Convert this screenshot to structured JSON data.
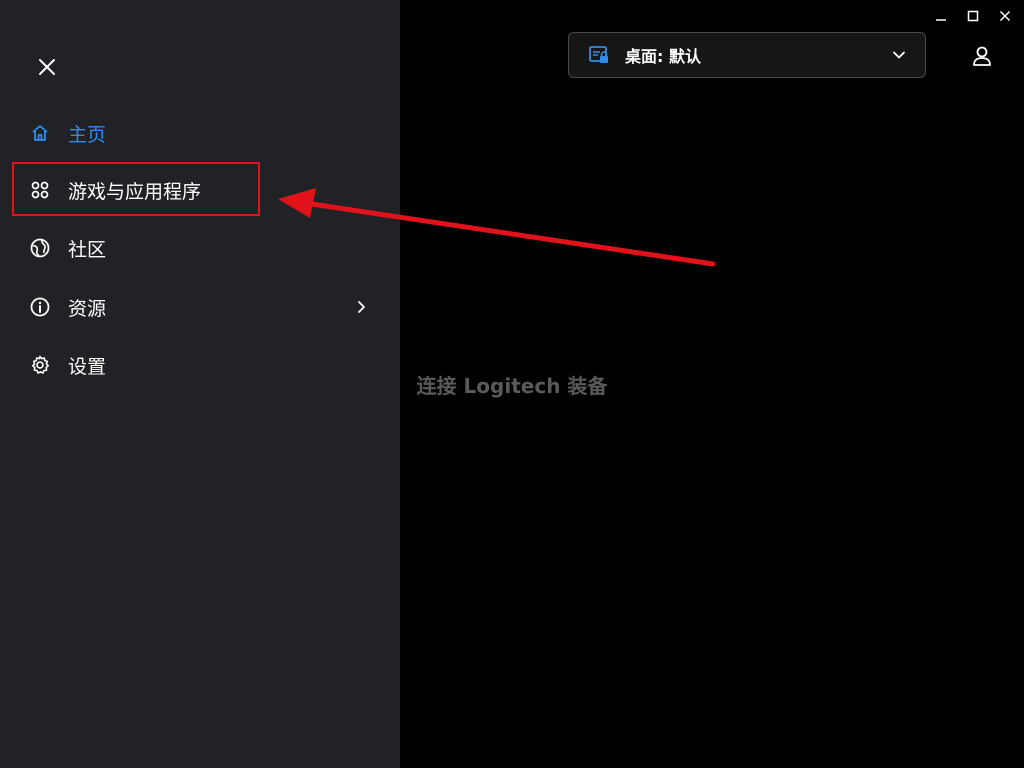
{
  "window": {
    "minimize_icon": "minimize-icon",
    "maximize_icon": "maximize-icon",
    "close_icon": "close-icon"
  },
  "sidebar": {
    "close_icon": "close-x-icon",
    "items": [
      {
        "label": "主页",
        "icon": "home-icon",
        "active": true
      },
      {
        "label": "游戏与应用程序",
        "icon": "apps-grid-icon",
        "active": false
      },
      {
        "label": "社区",
        "icon": "community-globe-icon",
        "active": false
      },
      {
        "label": "资源",
        "icon": "info-icon",
        "active": false,
        "has_submenu": true
      },
      {
        "label": "设置",
        "icon": "gear-icon",
        "active": false
      }
    ]
  },
  "header": {
    "profile_label": "桌面: 默认",
    "profile_icon": "desktop-profile-icon",
    "user_icon": "user-icon"
  },
  "main": {
    "message": "连接 Logitech 装备"
  },
  "colors": {
    "accent": "#2d8ef0",
    "sidebar_bg": "#212226",
    "background": "#000000",
    "annotation_red": "#e0121a"
  }
}
